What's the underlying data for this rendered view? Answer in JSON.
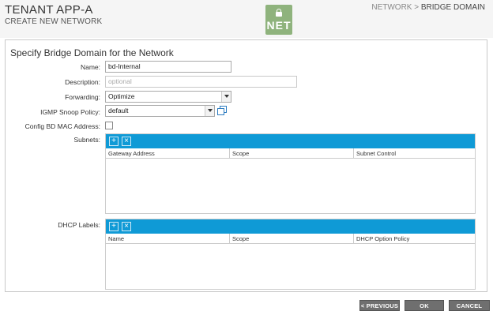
{
  "header": {
    "title": "TENANT APP-A",
    "subtitle": "CREATE NEW NETWORK",
    "logo_text": "NET",
    "breadcrumb": {
      "parent": "NETWORK",
      "separator": ">",
      "current": "BRIDGE DOMAIN"
    }
  },
  "form": {
    "title": "Specify Bridge Domain for the Network",
    "name": {
      "label": "Name:",
      "value": "bd-Internal"
    },
    "description": {
      "label": "Description:",
      "placeholder": "optional"
    },
    "forwarding": {
      "label": "Forwarding:",
      "value": "Optimize"
    },
    "igmp": {
      "label": "IGMP Snoop Policy:",
      "value": "default"
    },
    "config_mac": {
      "label": "Config BD MAC Address:",
      "checked": false
    }
  },
  "subnets": {
    "label": "Subnets:",
    "columns": [
      "Gateway Address",
      "Scope",
      "Subnet Control"
    ]
  },
  "dhcp": {
    "label": "DHCP Labels:",
    "columns": [
      "Name",
      "Scope",
      "DHCP Option Policy"
    ]
  },
  "footer": {
    "previous": "< PREVIOUS",
    "ok": "OK",
    "cancel": "CANCEL"
  },
  "colors": {
    "toolbar": "#0f9ad6",
    "logo": "#8fb37d",
    "button": "#6f6f6f"
  },
  "icons": {
    "logo": "lock-icon",
    "create_from_policy": "copy-icon",
    "add": "add-icon",
    "delete": "delete-icon"
  }
}
